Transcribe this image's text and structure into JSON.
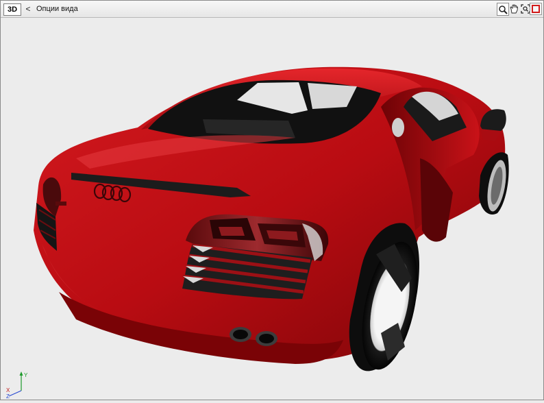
{
  "toolbar": {
    "view_badge": "3D",
    "back_glyph": "<",
    "view_options_label": "Опции вида",
    "tools": [
      "zoom-icon",
      "pan-hand-icon",
      "zoom-extents-icon"
    ],
    "close_color": "#d11a1a"
  },
  "viewport": {
    "model": "red-sports-car",
    "body_color": "#c20a10",
    "background_color": "#ececec"
  },
  "triad": {
    "y_label": "Y",
    "x_label": "X",
    "z_label": "Z"
  }
}
